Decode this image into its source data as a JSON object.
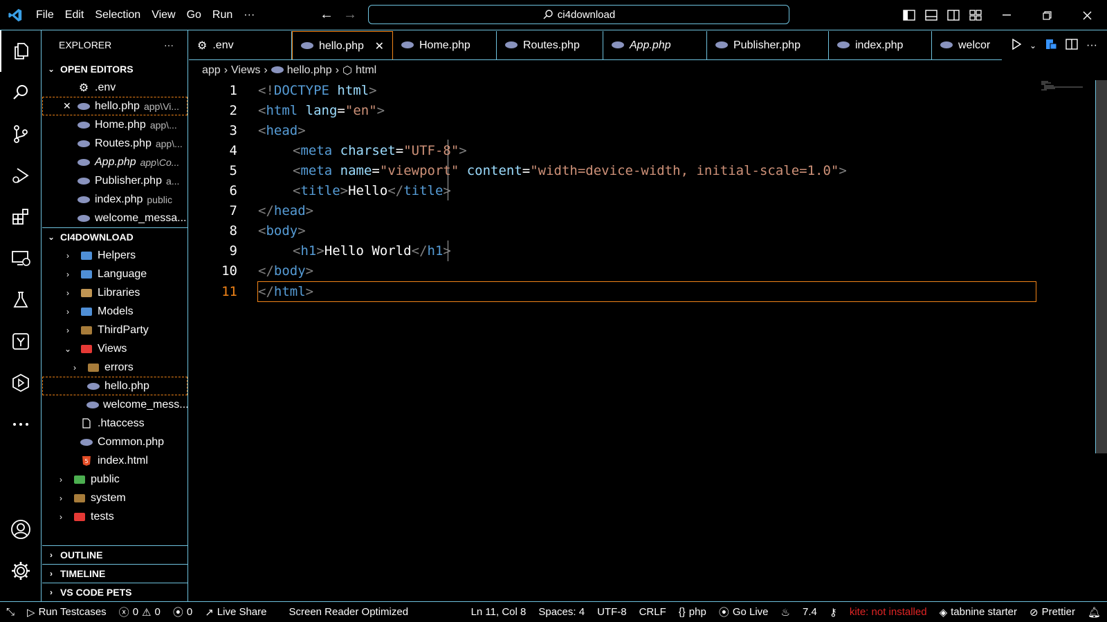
{
  "title_bar": {
    "menu": [
      "File",
      "Edit",
      "Selection",
      "View",
      "Go",
      "Run"
    ],
    "more": "···",
    "search_text": "ci4download"
  },
  "sidebar": {
    "title": "EXPLORER",
    "more": "···",
    "open_editors_title": "OPEN EDITORS",
    "open_editors": [
      {
        "label": ".env",
        "desc": "",
        "icon": "gear-icon"
      },
      {
        "label": "hello.php",
        "desc": "app\\Vi...",
        "icon": "php-icon",
        "close": "✕"
      },
      {
        "label": "Home.php",
        "desc": "app\\...",
        "icon": "php-icon"
      },
      {
        "label": "Routes.php",
        "desc": "app\\...",
        "icon": "php-icon"
      },
      {
        "label": "App.php",
        "desc": "app\\Co...",
        "icon": "php-icon"
      },
      {
        "label": "Publisher.php",
        "desc": "a...",
        "icon": "php-icon"
      },
      {
        "label": "index.php",
        "desc": "public",
        "icon": "php-icon"
      },
      {
        "label": "welcome_messa...",
        "desc": "",
        "icon": "php-icon"
      }
    ],
    "project_title": "CI4DOWNLOAD",
    "tree": [
      {
        "label": "Helpers",
        "type": "folder"
      },
      {
        "label": "Language",
        "type": "folder"
      },
      {
        "label": "Libraries",
        "type": "folder"
      },
      {
        "label": "Models",
        "type": "folder"
      },
      {
        "label": "ThirdParty",
        "type": "folder"
      },
      {
        "label": "Views",
        "type": "folder-open"
      },
      {
        "label": "errors",
        "type": "folder"
      },
      {
        "label": "hello.php",
        "type": "php"
      },
      {
        "label": "welcome_mess...",
        "type": "php"
      },
      {
        "label": ".htaccess",
        "type": "file"
      },
      {
        "label": "Common.php",
        "type": "php"
      },
      {
        "label": "index.html",
        "type": "html"
      },
      {
        "label": "public",
        "type": "folder"
      },
      {
        "label": "system",
        "type": "folder"
      },
      {
        "label": "tests",
        "type": "folder"
      }
    ],
    "bottom_sections": [
      "OUTLINE",
      "TIMELINE",
      "VS CODE PETS"
    ]
  },
  "tabs": [
    {
      "label": ".env",
      "icon": "gear-icon"
    },
    {
      "label": "hello.php",
      "icon": "php-icon",
      "close": "✕"
    },
    {
      "label": "Home.php",
      "icon": "php-icon"
    },
    {
      "label": "Routes.php",
      "icon": "php-icon"
    },
    {
      "label": "App.php",
      "icon": "php-icon"
    },
    {
      "label": "Publisher.php",
      "icon": "php-icon"
    },
    {
      "label": "index.php",
      "icon": "php-icon"
    },
    {
      "label": "welcor",
      "icon": "php-icon"
    }
  ],
  "tab_actions_more": "···",
  "breadcrumbs": [
    "app",
    "Views",
    "hello.php",
    "html"
  ],
  "editor": {
    "line_numbers": [
      "1",
      "2",
      "3",
      "4",
      "5",
      "6",
      "7",
      "8",
      "9",
      "10",
      "11"
    ],
    "code": {
      "l1_open": "<!",
      "l1_doctype": "DOCTYPE",
      "l1_html": " html",
      "l1_close": ">",
      "l2_open": "<",
      "l2_tag": "html",
      "l2_attr": " lang",
      "l2_eq": "=",
      "l2_str": "\"en\"",
      "l2_close": ">",
      "l3_open": "<",
      "l3_tag": "head",
      "l3_close": ">",
      "l4_open": "<",
      "l4_tag": "meta",
      "l4_attr": " charset",
      "l4_eq": "=",
      "l4_str": "\"UTF-8\"",
      "l4_close": ">",
      "l5_open": "<",
      "l5_tag": "meta",
      "l5_attr1": " name",
      "l5_eq1": "=",
      "l5_str1": "\"viewport\"",
      "l5_attr2": " content",
      "l5_eq2": "=",
      "l5_str2": "\"width=device-width, initial-scale=1.0\"",
      "l5_close": ">",
      "l6_open": "<",
      "l6_tag": "title",
      "l6_close": ">",
      "l6_text": "Hello",
      "l6_endopen": "</",
      "l6_endtag": "title",
      "l6_endclose": ">",
      "l7_open": "</",
      "l7_tag": "head",
      "l7_close": ">",
      "l8_open": "<",
      "l8_tag": "body",
      "l8_close": ">",
      "l9_open": "<",
      "l9_tag": "h1",
      "l9_close": ">",
      "l9_text": "Hello World",
      "l9_endopen": "</",
      "l9_endtag": "h1",
      "l9_endclose": ">",
      "l10_open": "</",
      "l10_tag": "body",
      "l10_close": ">",
      "l11_open": "</",
      "l11_tag": "html",
      "l11_close": ">"
    }
  },
  "status_bar": {
    "run_testcases": "Run Testcases",
    "errors": "0",
    "warnings": "0",
    "ports": "0",
    "live_share": "Live Share",
    "screen_reader": "Screen Reader Optimized",
    "cursor": "Ln 11, Col 8",
    "spaces": "Spaces: 4",
    "encoding": "UTF-8",
    "eol": "CRLF",
    "language": "php",
    "go_live": "Go Live",
    "version": "7.4",
    "kite": "kite: not installed",
    "tabnine": "tabnine starter",
    "prettier": "Prettier"
  },
  "colors": {
    "border": "#6fc3df",
    "focus": "#f38518",
    "tag": "#569cd6",
    "attr": "#9cdcfe",
    "string": "#ce9178",
    "punctuation": "#808080"
  }
}
